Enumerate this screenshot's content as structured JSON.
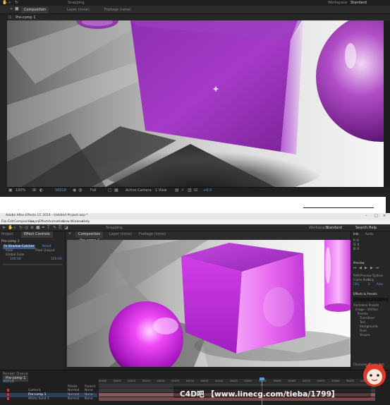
{
  "top_panel": {
    "tab_composition": "Composition",
    "tab_snapping": "Snapping",
    "tab_layer": "Layer (none)",
    "tab_footage": "Footage (none)",
    "workspace_label": "Workspace",
    "workspace_value": "Standard",
    "precomp_tab": "Pre-comp 1",
    "status": {
      "zoom": "100%",
      "timecode": "00018",
      "resolution": "Full",
      "camera": "Active Camera",
      "view": "1 View",
      "offset": "+0.0"
    }
  },
  "bottom_panel": {
    "window_title": "Adobe After Effects CC 2014 - Untitled Project.aep *",
    "menu": [
      "File",
      "Edit",
      "Composition",
      "Layer",
      "Effect",
      "Animation",
      "View",
      "Window",
      "Help"
    ],
    "snapping": "Snapping",
    "workspace_label": "Workspace",
    "workspace_value": "Standard",
    "tab_project": "Project",
    "tab_effect_controls": "Effect Controls",
    "tab_composition": "Composition",
    "tab_layer": "Layer (none)",
    "tab_footage": "Footage (none)",
    "precomp_tab": "Pre-comp 1",
    "left_panel": {
      "header": "Pre-comp 1",
      "effect_name": "Shadow Catcher",
      "reset": "Reset",
      "fx": "fx",
      "items": [
        "Fade",
        "Global Fade",
        "100.00",
        "100.00"
      ],
      "pixel_output": "Pixel Output"
    },
    "status": {
      "zoom": "100%",
      "timecode": "00018",
      "resolution": "Full",
      "camera": "Active Camera",
      "view": "1 View",
      "offset": "+0.0"
    },
    "right_panel": {
      "info": "Info",
      "audio": "Audio",
      "preview": "Preview",
      "ram_preview": "RAM Preview Options",
      "frame_rate": "Frame Rate",
      "skip": "Skip",
      "resolution": "Resolution",
      "frame_rate_val": "(30)",
      "skip_val": "0",
      "resolution_val": "Auto",
      "effects_presets": "Effects & Presets",
      "search": "Search Help",
      "tree": [
        "Animation Presets",
        "Image - Utilities",
        "Presets",
        "Transitions",
        "Text",
        "Backgrounds",
        "Paint",
        "Shapes"
      ],
      "char": "Character",
      "para": "Paragraph"
    },
    "timeline": {
      "tab": "Render Queue",
      "comp": "Pre-comp 1",
      "timecode": "00018",
      "layers": [
        "Camera",
        "Pre-comp 1",
        "White Solid 1"
      ],
      "mode_label": "Mode",
      "trkmat_label": "TrkMat",
      "parent_label": "Parent",
      "mode_values": [
        "Normal",
        "Normal",
        "Normal"
      ],
      "parent_values": [
        "None",
        "None",
        "None"
      ],
      "ruler": [
        "00000",
        "00005",
        "00010",
        "00015",
        "00020",
        "00025",
        "00030",
        "00035",
        "00040",
        "00045",
        "00050",
        "00055",
        "00060",
        "00065",
        "00070",
        "00075",
        "00080",
        "00085",
        "00090"
      ]
    },
    "watermark": "C4D吧 【www.linecg.com/tieba/1799】"
  },
  "colors": {
    "ui_dark": "#232323",
    "accent_blue": "#5b9bd5",
    "purple_cube": "#b03ad0",
    "magenta_sphere": "#e02ce8",
    "watermark_red": "#e23a2a"
  }
}
